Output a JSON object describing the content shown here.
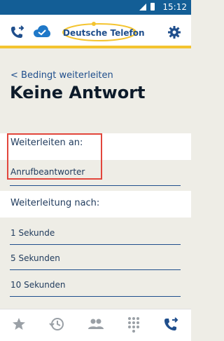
{
  "status_bar": {
    "time": "15:12"
  },
  "header": {
    "brand_name": "Deutsche Telefon",
    "accent_color": "#f4c430"
  },
  "page": {
    "back_label": "< Bedingt weiterleiten",
    "title": "Keine Antwort"
  },
  "forward_to": {
    "section_label": "Weiterleiten an:",
    "value": "Anrufbeantworter"
  },
  "forward_after": {
    "section_label": "Weiterleitung nach:",
    "options": [
      "1 Sekunde",
      "5 Sekunden",
      "10 Sekunden"
    ]
  },
  "bottom_nav": [
    "star-icon",
    "history-icon",
    "contacts-icon",
    "dialpad-icon",
    "call-forward-icon"
  ]
}
